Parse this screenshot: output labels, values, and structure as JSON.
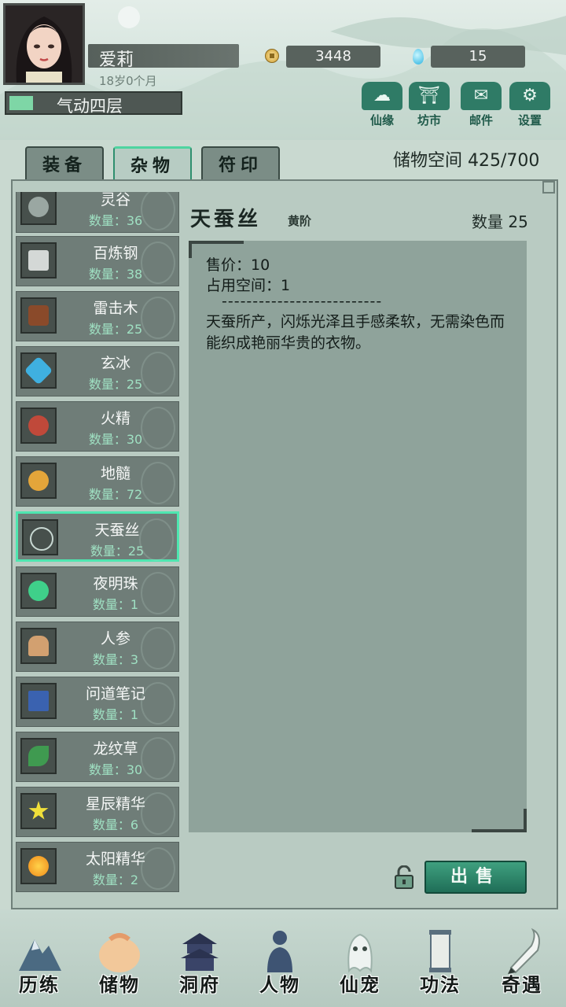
{
  "player": {
    "name": "爱莉",
    "age": "18岁0个月",
    "realm": "气动四层"
  },
  "currency": {
    "coins": "3448",
    "gems": "15"
  },
  "top_buttons": [
    {
      "label": "仙缘",
      "icon": "cloud-icon"
    },
    {
      "label": "坊市",
      "icon": "market-icon"
    },
    {
      "label": "邮件",
      "icon": "mail-icon"
    },
    {
      "label": "设置",
      "icon": "gear-icon"
    }
  ],
  "tabs": [
    {
      "label": "装备",
      "active": false
    },
    {
      "label": "杂物",
      "active": true
    },
    {
      "label": "符印",
      "active": false
    }
  ],
  "storage": {
    "label": "储物空间 425/700"
  },
  "items": [
    {
      "name": "灵谷",
      "qty": "数量：36",
      "color": "#9aa7a2"
    },
    {
      "name": "百炼钢",
      "qty": "数量：38",
      "color": "#d4d8d6"
    },
    {
      "name": "雷击木",
      "qty": "数量：25",
      "color": "#8a4a2a"
    },
    {
      "name": "玄冰",
      "qty": "数量：25",
      "color": "#3fb0e0"
    },
    {
      "name": "火精",
      "qty": "数量：30",
      "color": "#c0493a"
    },
    {
      "name": "地髓",
      "qty": "数量：72",
      "color": "#e3a53a"
    },
    {
      "name": "天蚕丝",
      "qty": "数量：25",
      "color": "#c8d8d2",
      "selected": true
    },
    {
      "name": "夜明珠",
      "qty": "数量：1",
      "color": "#3fd08a"
    },
    {
      "name": "人参",
      "qty": "数量：3",
      "color": "#d2a070"
    },
    {
      "name": "问道笔记",
      "qty": "数量：1",
      "color": "#3a62b0"
    },
    {
      "name": "龙纹草",
      "qty": "数量：30",
      "color": "#3f9a50"
    },
    {
      "name": "星辰精华",
      "qty": "数量：6",
      "color": "#f0df3a"
    },
    {
      "name": "太阳精华",
      "qty": "数量：2",
      "color": "#f09a1a"
    }
  ],
  "detail": {
    "title": "天蚕丝",
    "grade": "黄阶",
    "quantity": "数量 25",
    "price": "售价：10",
    "space": "占用空间：1",
    "divider": "--------------------------",
    "description": "天蚕所产，闪烁光泽且手感柔软，无需染色而能织成艳丽华贵的衣物。"
  },
  "sell_button": "出售",
  "bottom_nav": [
    {
      "label": "历练",
      "icon": "mountain-icon"
    },
    {
      "label": "储物",
      "icon": "pouch-icon"
    },
    {
      "label": "洞府",
      "icon": "pagoda-icon"
    },
    {
      "label": "人物",
      "icon": "person-icon"
    },
    {
      "label": "仙宠",
      "icon": "spirit-icon"
    },
    {
      "label": "功法",
      "icon": "scroll-icon"
    },
    {
      "label": "奇遇",
      "icon": "brush-icon"
    }
  ],
  "colors": {
    "accent": "#4ee6b0",
    "panel": "#b9cbc2",
    "button": "#2f7b66"
  }
}
